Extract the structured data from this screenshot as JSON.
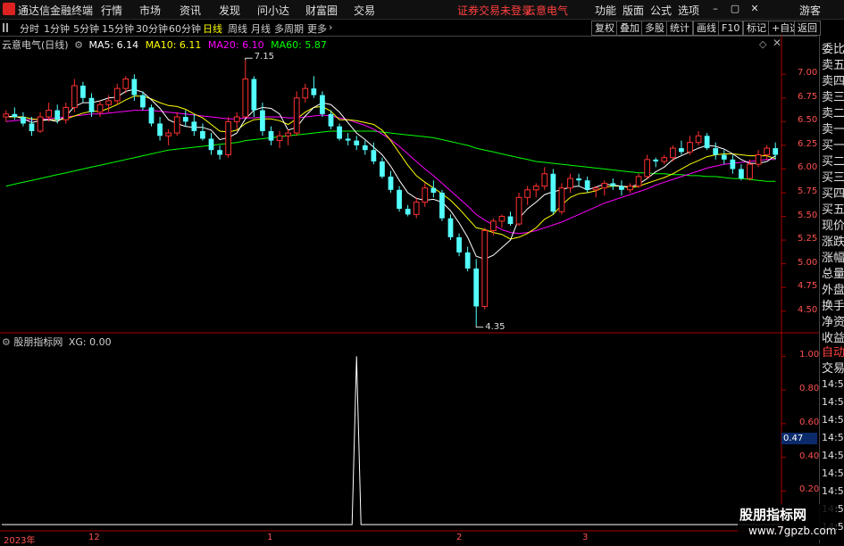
{
  "titlebar": {
    "app_name": "通达信金融终端",
    "menus": [
      "行情",
      "市场",
      "资讯",
      "发现",
      "问小达",
      "财富圈",
      "交易"
    ],
    "status": "证券交易未登录",
    "stock": "云意电气",
    "right_menus": [
      "功能",
      "版面",
      "公式",
      "选项"
    ],
    "guest": "游客"
  },
  "periods": [
    "分时",
    "1分钟",
    "5分钟",
    "15分钟",
    "30分钟",
    "60分钟",
    "日线",
    "周线",
    "月线",
    "多周期",
    "更多"
  ],
  "active_period": "日线",
  "toolbar_right": [
    "复权",
    "叠加",
    "多股",
    "统计",
    "画线",
    "F10",
    "标记",
    "+自选",
    "返回"
  ],
  "main_legend": {
    "name": "云意电气(日线)",
    "ma5": "MA5: 6.14",
    "ma10": "MA10: 6.11",
    "ma20": "MA20: 6.10",
    "ma60": "MA60: 5.87"
  },
  "colors": {
    "ma5": "#ffffff",
    "ma10": "#ffff00",
    "ma20": "#ff00ff",
    "ma60": "#00ff00",
    "up": "#ff3030",
    "down": "#54ffff",
    "axis": "#ff3030"
  },
  "price_axis": [
    "7.00",
    "6.75",
    "6.50",
    "6.25",
    "6.00",
    "5.75",
    "5.50",
    "5.25",
    "5.00",
    "4.75",
    "4.50"
  ],
  "high_label": "7.15",
  "low_label": "4.35",
  "right_panel": [
    "委比",
    "卖五",
    "卖四",
    "卖三",
    "卖二",
    "卖一",
    "买一",
    "买二",
    "买三",
    "买四",
    "买五",
    "现价",
    "涨跌",
    "涨幅",
    "总量",
    "外盘",
    "换手",
    "净资",
    "收益"
  ],
  "right_panel_bottom": [
    "自动",
    "交易"
  ],
  "times": [
    "14:56",
    "14:56",
    "14:56",
    "14:56",
    "14:56",
    "14:56",
    "14:56",
    "14:56",
    "14:56"
  ],
  "indicator": {
    "name": "股朋指标网",
    "xg": "XG: 0.00",
    "axis": [
      "1.00",
      "0.80",
      "0.60",
      "0.40",
      "0.20"
    ],
    "current": "0.47"
  },
  "date_axis": [
    "2023年",
    "12",
    "1",
    "2",
    "3"
  ],
  "watermark": {
    "line1": "股朋指标网",
    "line2": "www.7gpzb.com"
  },
  "chart_data": {
    "type": "candlestick",
    "ylim": [
      4.3,
      7.2
    ],
    "candles": [
      [
        6.55,
        6.62,
        6.5,
        6.58
      ],
      [
        6.58,
        6.65,
        6.52,
        6.55
      ],
      [
        6.55,
        6.6,
        6.45,
        6.48
      ],
      [
        6.48,
        6.55,
        6.35,
        6.4
      ],
      [
        6.4,
        6.6,
        6.38,
        6.55
      ],
      [
        6.55,
        6.7,
        6.5,
        6.62
      ],
      [
        6.62,
        6.68,
        6.48,
        6.52
      ],
      [
        6.52,
        6.7,
        6.48,
        6.65
      ],
      [
        6.65,
        6.95,
        6.6,
        6.88
      ],
      [
        6.88,
        6.92,
        6.7,
        6.75
      ],
      [
        6.75,
        6.8,
        6.55,
        6.6
      ],
      [
        6.6,
        6.72,
        6.55,
        6.68
      ],
      [
        6.68,
        6.78,
        6.6,
        6.72
      ],
      [
        6.72,
        6.9,
        6.68,
        6.85
      ],
      [
        6.85,
        6.98,
        6.8,
        6.95
      ],
      [
        6.95,
        7.0,
        6.72,
        6.78
      ],
      [
        6.78,
        6.82,
        6.62,
        6.65
      ],
      [
        6.65,
        6.68,
        6.45,
        6.48
      ],
      [
        6.48,
        6.55,
        6.3,
        6.35
      ],
      [
        6.35,
        6.42,
        6.25,
        6.38
      ],
      [
        6.38,
        6.6,
        6.35,
        6.55
      ],
      [
        6.55,
        6.62,
        6.45,
        6.5
      ],
      [
        6.5,
        6.58,
        6.35,
        6.4
      ],
      [
        6.4,
        6.48,
        6.3,
        6.32
      ],
      [
        6.32,
        6.38,
        6.15,
        6.2
      ],
      [
        6.2,
        6.25,
        6.1,
        6.15
      ],
      [
        6.15,
        6.55,
        6.12,
        6.5
      ],
      [
        6.5,
        6.6,
        6.42,
        6.55
      ],
      [
        6.55,
        7.15,
        6.55,
        6.95
      ],
      [
        6.95,
        6.98,
        6.55,
        6.62
      ],
      [
        6.62,
        6.7,
        6.35,
        6.4
      ],
      [
        6.4,
        6.45,
        6.25,
        6.3
      ],
      [
        6.3,
        6.4,
        6.22,
        6.35
      ],
      [
        6.35,
        6.42,
        6.25,
        6.38
      ],
      [
        6.38,
        6.82,
        6.35,
        6.75
      ],
      [
        6.75,
        6.9,
        6.7,
        6.85
      ],
      [
        6.85,
        6.98,
        6.75,
        6.78
      ],
      [
        6.78,
        6.82,
        6.55,
        6.58
      ],
      [
        6.58,
        6.62,
        6.42,
        6.45
      ],
      [
        6.45,
        6.48,
        6.3,
        6.32
      ],
      [
        6.32,
        6.38,
        6.25,
        6.3
      ],
      [
        6.3,
        6.35,
        6.2,
        6.25
      ],
      [
        6.25,
        6.3,
        6.15,
        6.2
      ],
      [
        6.2,
        6.28,
        6.05,
        6.08
      ],
      [
        6.08,
        6.12,
        5.9,
        5.92
      ],
      [
        5.92,
        5.98,
        5.75,
        5.78
      ],
      [
        5.78,
        5.82,
        5.55,
        5.58
      ],
      [
        5.58,
        5.62,
        5.5,
        5.52
      ],
      [
        5.52,
        5.7,
        5.48,
        5.65
      ],
      [
        5.65,
        5.85,
        5.6,
        5.8
      ],
      [
        5.8,
        5.88,
        5.7,
        5.75
      ],
      [
        5.75,
        5.78,
        5.45,
        5.48
      ],
      [
        5.48,
        5.52,
        5.25,
        5.28
      ],
      [
        5.28,
        5.32,
        5.08,
        5.12
      ],
      [
        5.12,
        5.18,
        4.92,
        4.95
      ],
      [
        4.95,
        5.05,
        4.35,
        4.55
      ],
      [
        4.55,
        5.38,
        4.52,
        5.35
      ],
      [
        5.35,
        5.48,
        5.3,
        5.45
      ],
      [
        5.45,
        5.52,
        5.38,
        5.5
      ],
      [
        5.5,
        5.55,
        5.4,
        5.42
      ],
      [
        5.42,
        5.75,
        5.4,
        5.7
      ],
      [
        5.7,
        5.82,
        5.62,
        5.78
      ],
      [
        5.78,
        5.85,
        5.7,
        5.82
      ],
      [
        5.82,
        6.02,
        5.78,
        5.95
      ],
      [
        5.95,
        6.0,
        5.52,
        5.55
      ],
      [
        5.55,
        5.85,
        5.52,
        5.8
      ],
      [
        5.8,
        5.95,
        5.75,
        5.9
      ],
      [
        5.9,
        5.95,
        5.82,
        5.88
      ],
      [
        5.88,
        5.92,
        5.75,
        5.78
      ],
      [
        5.78,
        5.82,
        5.7,
        5.8
      ],
      [
        5.8,
        5.88,
        5.72,
        5.85
      ],
      [
        5.85,
        5.9,
        5.78,
        5.82
      ],
      [
        5.82,
        5.88,
        5.72,
        5.78
      ],
      [
        5.78,
        5.85,
        5.75,
        5.82
      ],
      [
        5.82,
        5.95,
        5.8,
        5.92
      ],
      [
        5.92,
        6.15,
        5.9,
        6.1
      ],
      [
        6.1,
        6.12,
        6.02,
        6.08
      ],
      [
        6.08,
        6.15,
        6.05,
        6.12
      ],
      [
        6.12,
        6.25,
        6.08,
        6.22
      ],
      [
        6.22,
        6.3,
        6.15,
        6.18
      ],
      [
        6.18,
        6.35,
        6.15,
        6.28
      ],
      [
        6.28,
        6.4,
        6.25,
        6.35
      ],
      [
        6.35,
        6.38,
        6.2,
        6.22
      ],
      [
        6.22,
        6.28,
        6.1,
        6.15
      ],
      [
        6.15,
        6.2,
        6.05,
        6.1
      ],
      [
        6.1,
        6.15,
        5.95,
        6.0
      ],
      [
        6.0,
        6.05,
        5.88,
        5.9
      ],
      [
        5.9,
        6.1,
        5.88,
        6.05
      ],
      [
        6.05,
        6.2,
        6.02,
        6.15
      ],
      [
        6.15,
        6.25,
        6.1,
        6.22
      ],
      [
        6.22,
        6.28,
        6.1,
        6.15
      ]
    ],
    "ma5": [
      6.55,
      6.56,
      6.53,
      6.49,
      6.51,
      6.52,
      6.5,
      6.56,
      6.66,
      6.7,
      6.7,
      6.72,
      6.75,
      6.76,
      6.82,
      6.84,
      6.81,
      6.73,
      6.64,
      6.52,
      6.48,
      6.45,
      6.44,
      6.44,
      6.41,
      6.31,
      6.33,
      6.38,
      6.53,
      6.62,
      6.65,
      6.64,
      6.58,
      6.41,
      6.44,
      6.56,
      6.65,
      6.7,
      6.68,
      6.6,
      6.49,
      6.38,
      6.31,
      6.23,
      6.15,
      6.03,
      5.88,
      5.75,
      5.69,
      5.67,
      5.68,
      5.65,
      5.56,
      5.43,
      5.28,
      5.08,
      5.05,
      5.09,
      5.17,
      5.25,
      5.48,
      5.58,
      5.65,
      5.73,
      5.76,
      5.78,
      5.81,
      5.82,
      5.78,
      5.81,
      5.84,
      5.83,
      5.82,
      5.81,
      5.84,
      5.9,
      5.97,
      6.02,
      6.1,
      6.14,
      6.18,
      6.22,
      6.25,
      6.24,
      6.21,
      6.16,
      6.1,
      6.06,
      6.06,
      6.08,
      6.14
    ],
    "ma10": [
      6.55,
      6.55,
      6.55,
      6.53,
      6.52,
      6.52,
      6.52,
      6.53,
      6.56,
      6.59,
      6.61,
      6.61,
      6.64,
      6.68,
      6.73,
      6.77,
      6.77,
      6.74,
      6.7,
      6.67,
      6.66,
      6.63,
      6.58,
      6.54,
      6.47,
      6.4,
      6.39,
      6.41,
      6.48,
      6.52,
      6.53,
      6.53,
      6.51,
      6.47,
      6.53,
      6.6,
      6.65,
      6.66,
      6.61,
      6.52,
      6.52,
      6.51,
      6.49,
      6.47,
      6.41,
      6.3,
      6.17,
      6.04,
      5.93,
      5.86,
      5.8,
      5.74,
      5.67,
      5.58,
      5.48,
      5.38,
      5.36,
      5.33,
      5.31,
      5.26,
      5.28,
      5.32,
      5.38,
      5.47,
      5.52,
      5.62,
      5.7,
      5.74,
      5.75,
      5.77,
      5.81,
      5.82,
      5.82,
      5.8,
      5.82,
      5.85,
      5.88,
      5.91,
      5.95,
      6.0,
      6.05,
      6.09,
      6.13,
      6.15,
      6.16,
      6.16,
      6.15,
      6.14,
      6.14,
      6.14,
      6.11
    ],
    "ma20": [
      6.5,
      6.51,
      6.52,
      6.52,
      6.53,
      6.53,
      6.54,
      6.55,
      6.56,
      6.57,
      6.58,
      6.58,
      6.59,
      6.6,
      6.61,
      6.62,
      6.62,
      6.62,
      6.61,
      6.6,
      6.59,
      6.58,
      6.57,
      6.56,
      6.55,
      6.54,
      6.53,
      6.53,
      6.54,
      6.54,
      6.55,
      6.55,
      6.55,
      6.54,
      6.54,
      6.55,
      6.56,
      6.57,
      6.56,
      6.54,
      6.52,
      6.49,
      6.46,
      6.42,
      6.37,
      6.31,
      6.24,
      6.16,
      6.08,
      6.0,
      5.93,
      5.85,
      5.77,
      5.69,
      5.61,
      5.52,
      5.46,
      5.41,
      5.36,
      5.33,
      5.32,
      5.33,
      5.35,
      5.38,
      5.41,
      5.44,
      5.48,
      5.52,
      5.56,
      5.6,
      5.64,
      5.67,
      5.7,
      5.73,
      5.76,
      5.79,
      5.83,
      5.86,
      5.89,
      5.92,
      5.95,
      5.98,
      6.01,
      6.03,
      6.05,
      6.06,
      6.07,
      6.08,
      6.09,
      6.1,
      6.1
    ],
    "ma60": [
      5.82,
      5.84,
      5.86,
      5.88,
      5.9,
      5.92,
      5.94,
      5.96,
      5.98,
      6.0,
      6.02,
      6.04,
      6.06,
      6.08,
      6.1,
      6.12,
      6.14,
      6.16,
      6.18,
      6.2,
      6.21,
      6.22,
      6.23,
      6.24,
      6.25,
      6.26,
      6.27,
      6.28,
      6.3,
      6.31,
      6.32,
      6.33,
      6.34,
      6.35,
      6.36,
      6.37,
      6.38,
      6.39,
      6.4,
      6.4,
      6.4,
      6.4,
      6.4,
      6.4,
      6.39,
      6.38,
      6.37,
      6.36,
      6.35,
      6.34,
      6.33,
      6.31,
      6.29,
      6.27,
      6.25,
      6.22,
      6.2,
      6.18,
      6.16,
      6.14,
      6.12,
      6.1,
      6.08,
      6.07,
      6.06,
      6.05,
      6.04,
      6.03,
      6.02,
      6.01,
      6.0,
      5.99,
      5.98,
      5.97,
      5.96,
      5.96,
      5.95,
      5.95,
      5.94,
      5.94,
      5.93,
      5.93,
      5.92,
      5.92,
      5.91,
      5.9,
      5.9,
      5.89,
      5.88,
      5.87,
      5.87
    ],
    "xg": {
      "spike_index": 41,
      "value": 1.0,
      "ylim": [
        0,
        1.05
      ]
    }
  }
}
